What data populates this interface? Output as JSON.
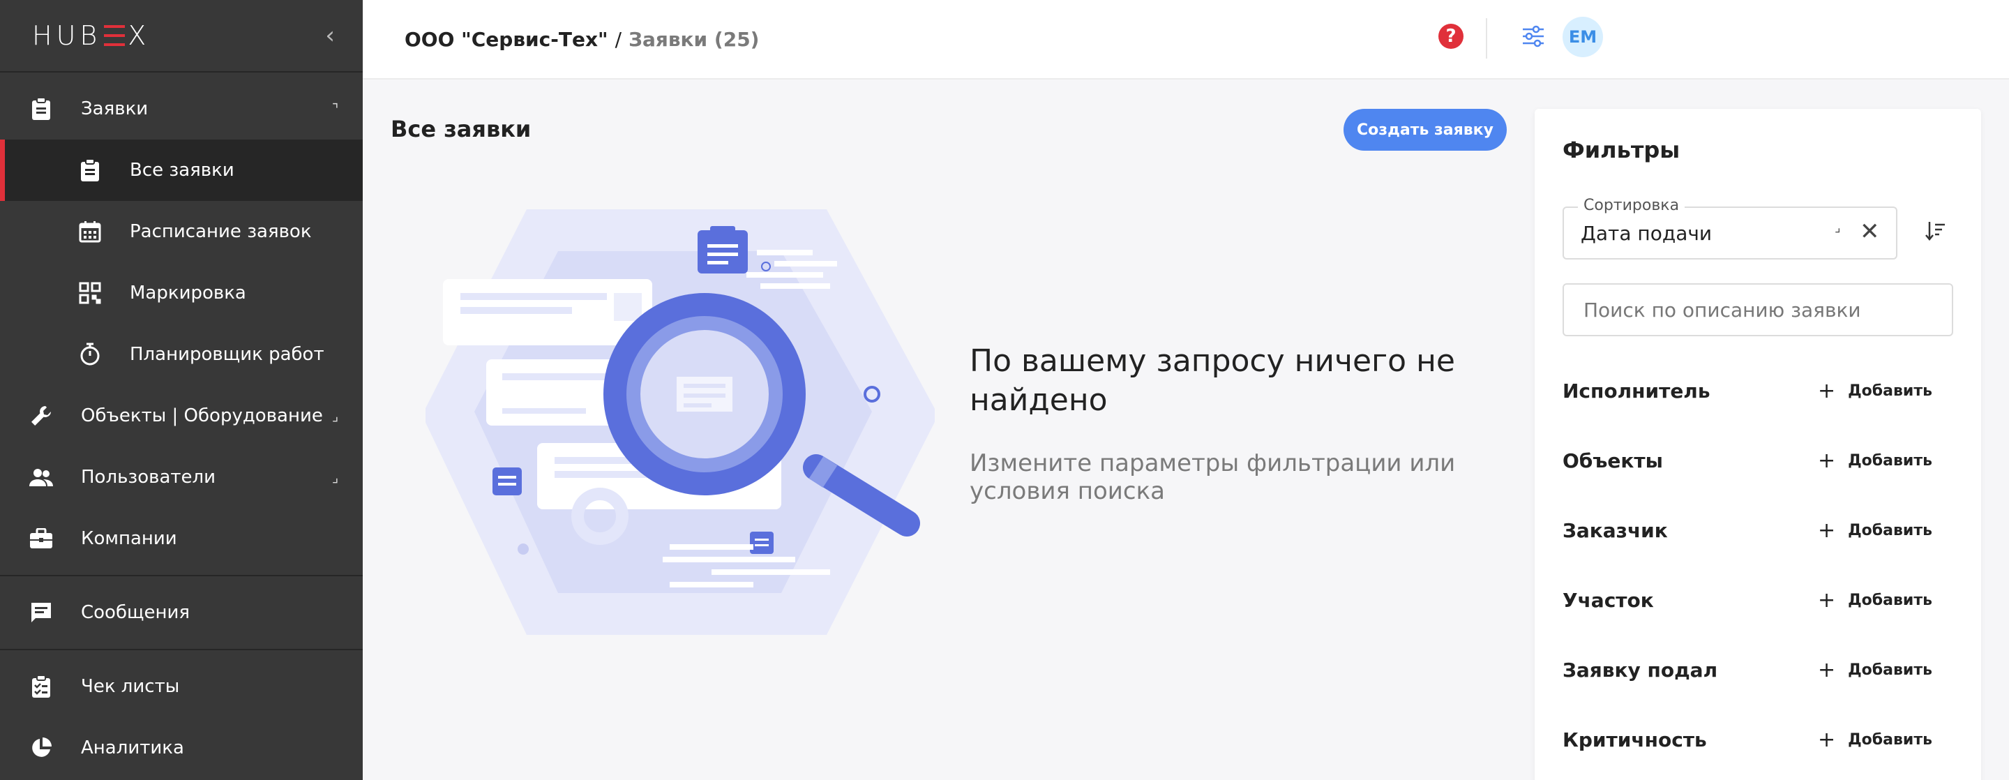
{
  "app": {
    "logo": "HUBEX",
    "logo_left": "HUB",
    "logo_right": "X"
  },
  "sidebar": {
    "collapse_glyph": "‹",
    "items": [
      {
        "label": "Заявки",
        "icon": "clipboard-icon",
        "arrow": "⌝"
      },
      {
        "label": "Все заявки",
        "icon": "clipboard-icon",
        "active": true
      },
      {
        "label": "Расписание заявок",
        "icon": "calendar-icon"
      },
      {
        "label": "Маркировка",
        "icon": "qr-code-icon"
      },
      {
        "label": "Планировщик работ",
        "icon": "stopwatch-icon"
      },
      {
        "label": "Объекты | Оборудование",
        "icon": "wrench-icon",
        "arrow": "⌟"
      },
      {
        "label": "Пользователи",
        "icon": "users-icon",
        "arrow": "⌟"
      },
      {
        "label": "Компании",
        "icon": "briefcase-icon"
      },
      {
        "label": "Сообщения",
        "icon": "message-icon"
      },
      {
        "label": "Чек листы",
        "icon": "checklist-icon"
      },
      {
        "label": "Аналитика",
        "icon": "pie-chart-icon"
      }
    ]
  },
  "header": {
    "company": "ООО \"Сервис-Тех\"",
    "separator": "/",
    "section": "Заявки (25)",
    "help_glyph": "?",
    "avatar_initials": "EM"
  },
  "main": {
    "title": "Все заявки",
    "create_button": "Создать заявку",
    "empty_title": "По вашему запросу ничего не найдено",
    "empty_subtitle": "Измените параметры фильтрации или условия поиска"
  },
  "filters": {
    "title": "Фильтры",
    "sort_label": "Сортировка",
    "sort_value": "Дата подачи",
    "sort_caret": "⌟",
    "clear_glyph": "✕",
    "search_placeholder": "Поиск по описанию заявки",
    "add_label": "Добавить",
    "add_glyph": "+",
    "rows": [
      "Исполнитель",
      "Объекты",
      "Заказчик",
      "Участок",
      "Заявку подал",
      "Критичность"
    ]
  },
  "colors": {
    "accent": "#4f86f0",
    "brand_red": "#e0303a",
    "sidebar_bg": "#383838",
    "illustration": "#5a6fdc"
  }
}
